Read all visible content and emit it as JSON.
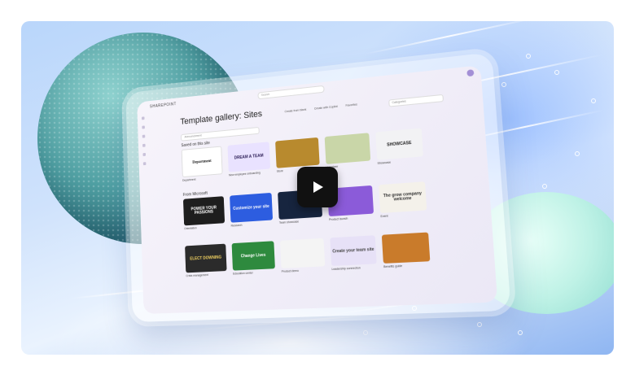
{
  "app": {
    "title": "SHAREPOINT",
    "search_placeholder": "Search"
  },
  "gallery": {
    "heading": "Template gallery: Sites",
    "filter_placeholder": "Announcement",
    "toolbar": [
      "Create from blank",
      "Create with Copilot",
      "Favorites"
    ],
    "sort_label": "Categories",
    "saved_label": "Saved on this site",
    "saved_items": [
      {
        "caption": "Department",
        "img_text": "Department",
        "bg": "#ffffff",
        "fg": "#111111"
      },
      {
        "caption": "New employee onboarding",
        "img_text": "DREAM A TEAM",
        "bg": "#e9e2ff",
        "fg": "#2a1c55"
      },
      {
        "caption": "Store",
        "img_text": "",
        "bg": "#b88a2e",
        "fg": "#ffffff"
      },
      {
        "caption": "Volunteer",
        "img_text": "",
        "bg": "#c9d6a8",
        "fg": "#333333"
      },
      {
        "caption": "Showcase",
        "img_text": "SHOWCASE",
        "bg": "#f2f2f4",
        "fg": "#222222"
      }
    ],
    "microsoft_label": "From Microsoft",
    "microsoft_items": [
      {
        "caption": "Orientation",
        "img_text": "POWER YOUR PASSIONS",
        "bg": "#1e1e1e",
        "fg": "#ffffff"
      },
      {
        "caption": "Research",
        "img_text": "Customize your site",
        "bg": "#2d5de0",
        "fg": "#ffffff"
      },
      {
        "caption": "Team showcase",
        "img_text": "",
        "bg": "#17253f",
        "fg": "#ffffff"
      },
      {
        "caption": "Product launch",
        "img_text": "",
        "bg": "#8b5bd9",
        "fg": "#ffffff"
      },
      {
        "caption": "Event",
        "img_text": "The grow company welcome",
        "bg": "#f4f1ea",
        "fg": "#333333"
      }
    ],
    "row3_items": [
      {
        "caption": "Crisis management",
        "img_text": "ELECT DOWNING",
        "bg": "#2b2b2b",
        "fg": "#f0d060"
      },
      {
        "caption": "Education center",
        "img_text": "Change Lives",
        "bg": "#2e8a3e",
        "fg": "#ffffff"
      },
      {
        "caption": "Product demo",
        "img_text": "",
        "bg": "#f4f4f4",
        "fg": "#222222"
      },
      {
        "caption": "Leadership connection",
        "img_text": "Create your team site",
        "bg": "#e7e1f7",
        "fg": "#444444"
      },
      {
        "caption": "Benefits guide",
        "img_text": "",
        "bg": "#c97b2b",
        "fg": "#ffffff"
      }
    ]
  },
  "video": {
    "play_icon": "play-icon"
  }
}
